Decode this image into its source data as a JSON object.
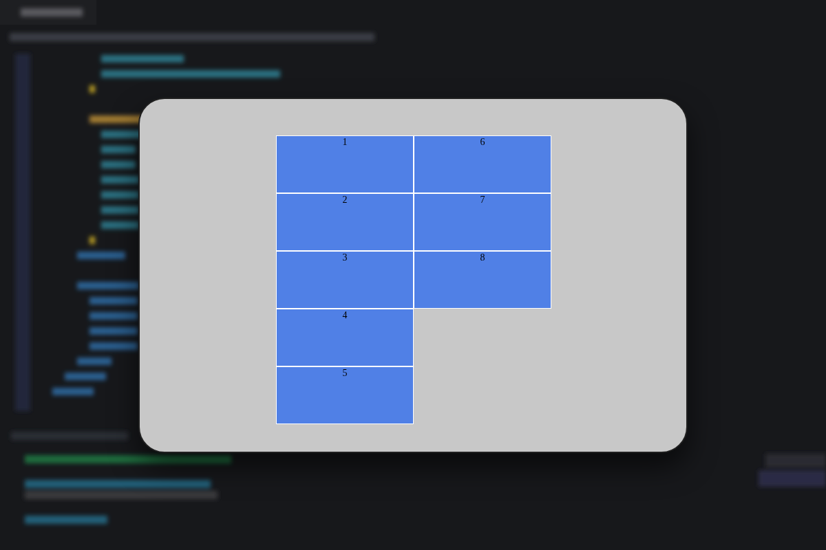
{
  "flex_items": [
    {
      "label": "1"
    },
    {
      "label": "2"
    },
    {
      "label": "3"
    },
    {
      "label": "4"
    },
    {
      "label": "5"
    },
    {
      "label": "6"
    },
    {
      "label": "7"
    },
    {
      "label": "8"
    }
  ]
}
